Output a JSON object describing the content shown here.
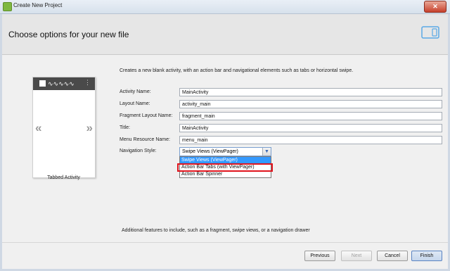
{
  "window": {
    "title": "Create New Project",
    "close_glyph": "✕"
  },
  "header": {
    "title": "Choose options for your new file",
    "icon": "tablet-icon"
  },
  "preview": {
    "label": "Tabbed Activity",
    "wave": "∿∿∿∿∿",
    "dots": "⋮",
    "left_chevron": "«",
    "right_chevron": "»"
  },
  "description": "Creates a new blank activity, with an action bar and navigational elements such as tabs or horizontal swipe.",
  "form": {
    "activity_name": {
      "label": "Activity Name:",
      "value": "MainActivity"
    },
    "layout_name": {
      "label": "Layout Name:",
      "value": "activity_main"
    },
    "fragment_layout_name": {
      "label": "Fragment Layout Name:",
      "value": "fragment_main"
    },
    "title": {
      "label": "Title:",
      "value": "MainActivity"
    },
    "menu_resource_name": {
      "label": "Menu Resource Name:",
      "value": "menu_main"
    },
    "navigation_style": {
      "label": "Navigation Style:",
      "value": "Swipe Views (ViewPager)",
      "arrow": "▼",
      "options": [
        "Swipe Views (ViewPager)",
        "Action Bar Tabs (with ViewPager)",
        "Action Bar Spinner"
      ]
    }
  },
  "footer_description": "Additional features to include, such as a fragment, swipe views, or a navigation drawer",
  "buttons": {
    "previous": "Previous",
    "next": "Next",
    "cancel": "Cancel",
    "finish": "Finish"
  },
  "colors": {
    "dropdown_selected": "#3399ff",
    "highlight_border": "#e0141d"
  }
}
